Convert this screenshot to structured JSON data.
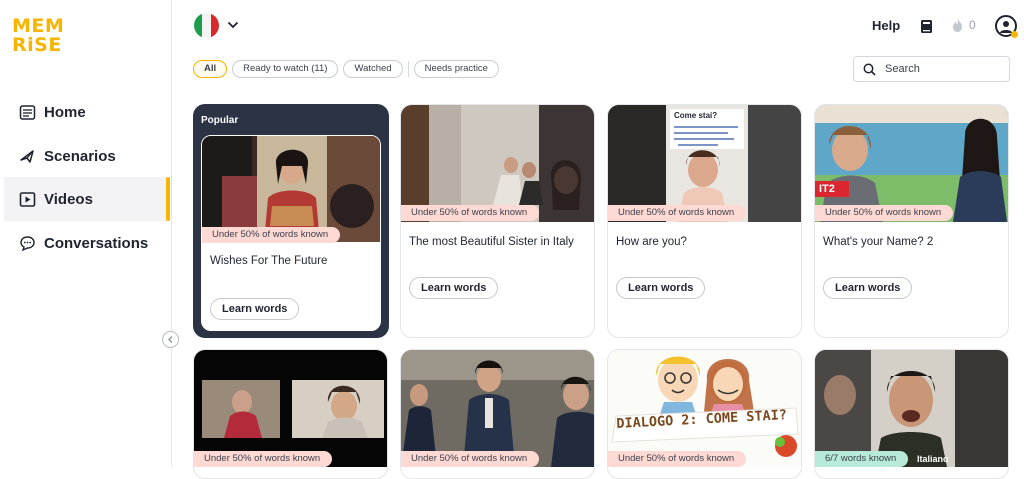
{
  "brand": {
    "logo_line1": "MEM",
    "logo_line2": "RiSE",
    "color": "#f7b500"
  },
  "sidebar": {
    "items": [
      {
        "label": "Home",
        "icon": "home-icon",
        "active": false
      },
      {
        "label": "Scenarios",
        "icon": "scenarios-icon",
        "active": false
      },
      {
        "label": "Videos",
        "icon": "videos-icon",
        "active": true
      },
      {
        "label": "Conversations",
        "icon": "conversations-icon",
        "active": false
      }
    ]
  },
  "header": {
    "language_flag": "italian-flag-icon",
    "help_label": "Help",
    "streak_count": "0"
  },
  "filters": {
    "chips": [
      "All",
      "Ready to watch (11)",
      "Watched",
      "Needs practice"
    ],
    "selected": "All"
  },
  "search": {
    "placeholder": "Search"
  },
  "featured": {
    "label": "Popular"
  },
  "cards": [
    {
      "badge": "Under 50% of words known",
      "title": "Wishes For The Future",
      "button": "Learn words"
    },
    {
      "badge": "Under 50% of words known",
      "title": "The most Beautiful Sister in Italy",
      "button": "Learn words"
    },
    {
      "badge": "Under 50% of words known",
      "title": "How are you?",
      "button": "Learn words"
    },
    {
      "badge": "Under 50% of words known",
      "title": "What's your Name? 2",
      "button": "Learn words"
    },
    {
      "badge": "Under 50% of words known"
    },
    {
      "badge": "Under 50% of words known"
    },
    {
      "badge": "Under 50% of words known"
    },
    {
      "badge": "6/7 words known"
    }
  ],
  "thumb_text": {
    "card3_overlay": "Come stai?",
    "card4_tag": "IT2",
    "card7_caption": "DIALOGO 2: COME STAI?",
    "card8_caption": "Italiano"
  },
  "colors": {
    "accent": "#f7b500",
    "badge_red": "#ffd9d4",
    "badge_green": "#b7ead8",
    "featured_bg": "#2b3345"
  }
}
